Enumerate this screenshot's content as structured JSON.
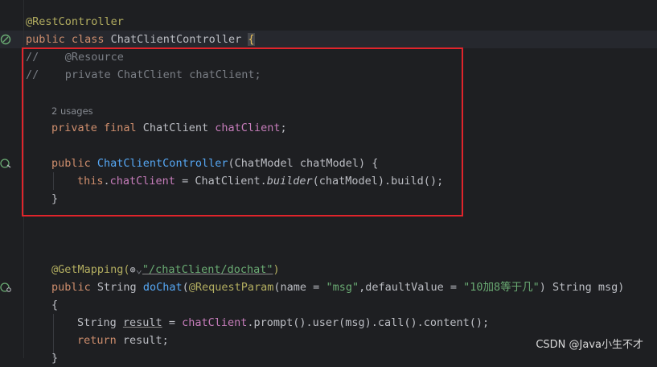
{
  "code": {
    "l1_annotation": "@RestController",
    "l2_kw": "public class ",
    "l2_class": "ChatClientController ",
    "l2_brace": "{",
    "l3_comment": "//    @Resource",
    "l4_comment": "//    private ChatClient chatClient;",
    "usages": "2 usages",
    "l6_kw": "private final ",
    "l6_type": "ChatClient ",
    "l6_field": "chatClient",
    "l6_end": ";",
    "l8_kw": "public ",
    "l8_ctor": "ChatClientController",
    "l8_params": "(ChatModel chatModel) {",
    "l9_this": "this",
    "l9_dot": ".",
    "l9_field": "chatClient",
    "l9_mid": " = ChatClient.",
    "l9_builder": "builder",
    "l9_end": "(chatModel).build();",
    "l10_brace": "}",
    "l14_annotation": "@GetMapping(",
    "l14_globe": "⊕",
    "l14_chev": "⌄",
    "l14_path": "\"/chatClient/dochat\"",
    "l14_end": ")",
    "l15_kw": "public ",
    "l15_type": "String ",
    "l15_method": "doChat",
    "l15_open": "(",
    "l15_ann": "@RequestParam",
    "l15_params_a": "(name = ",
    "l15_str1": "\"msg\"",
    "l15_params_b": ",defaultValue = ",
    "l15_str2": "\"10加8等于几\"",
    "l15_params_c": ") String msg)",
    "l16_brace": "{",
    "l17_type": "String ",
    "l17_var": "result",
    "l17_eq": " = ",
    "l17_field": "chatClient",
    "l17_rest": ".prompt().user(msg).call().content();",
    "l18_kw": "return ",
    "l18_rest": "result;",
    "l19_brace": "}"
  },
  "watermark": "CSDN @Java小生不才",
  "colors": {
    "background": "#1e1f22",
    "keyword": "#cf8e6d",
    "annotation": "#b3ae60",
    "comment": "#7a7e85",
    "field": "#c77dbb",
    "method": "#56a8f5",
    "string": "#6aab73",
    "selection_border": "#e0242b"
  },
  "icons": {
    "gutter_bean": "spring-bean-icon",
    "gutter_ctor": "constructor-bean-icon",
    "gutter_mapping": "request-mapping-icon"
  }
}
